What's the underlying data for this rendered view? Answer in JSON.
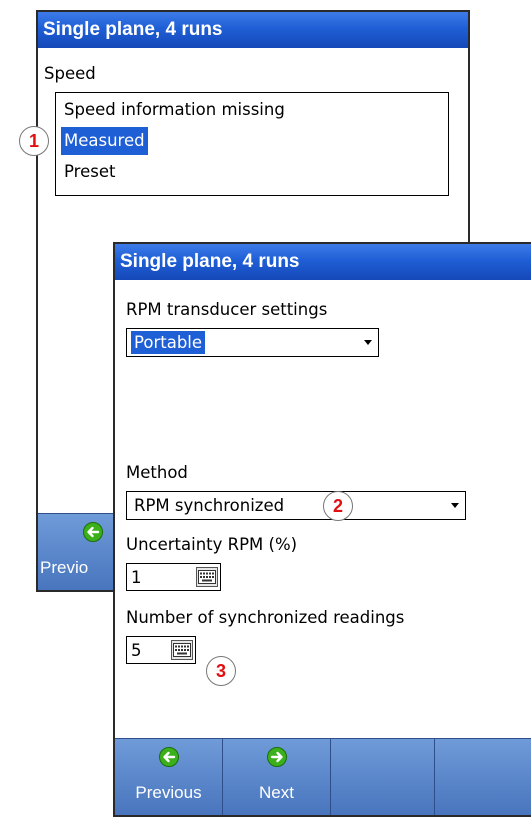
{
  "screen1": {
    "title": "Single plane, 4 runs",
    "speed_label": "Speed",
    "speed_options": [
      "Speed information missing",
      "Measured",
      "Preset"
    ],
    "selected_option": "Measured",
    "toolbar": {
      "previous_label": "Previo"
    }
  },
  "screen2": {
    "title": "Single plane, 4 runs",
    "rpm_transducer_label": "RPM transducer settings",
    "rpm_transducer_value": "Portable",
    "method_label": "Method",
    "method_value": "RPM synchronized",
    "uncertainty_label": "Uncertainty RPM (%)",
    "uncertainty_value": "1",
    "sync_readings_label": "Number of synchronized readings",
    "sync_readings_value": "5",
    "toolbar": {
      "previous_label": "Previous",
      "next_label": "Next"
    }
  },
  "markers": [
    "1",
    "2",
    "3"
  ],
  "colors": {
    "title_bar": "#1f5fd6",
    "selection": "#1f5fd6",
    "toolbar": "#5a86cc",
    "marker_text": "#e01010",
    "nav_icon": "#3cb01a"
  },
  "icons": {
    "previous": "arrow-left-circle-icon",
    "next": "arrow-right-circle-icon",
    "keyboard": "keyboard-icon"
  }
}
